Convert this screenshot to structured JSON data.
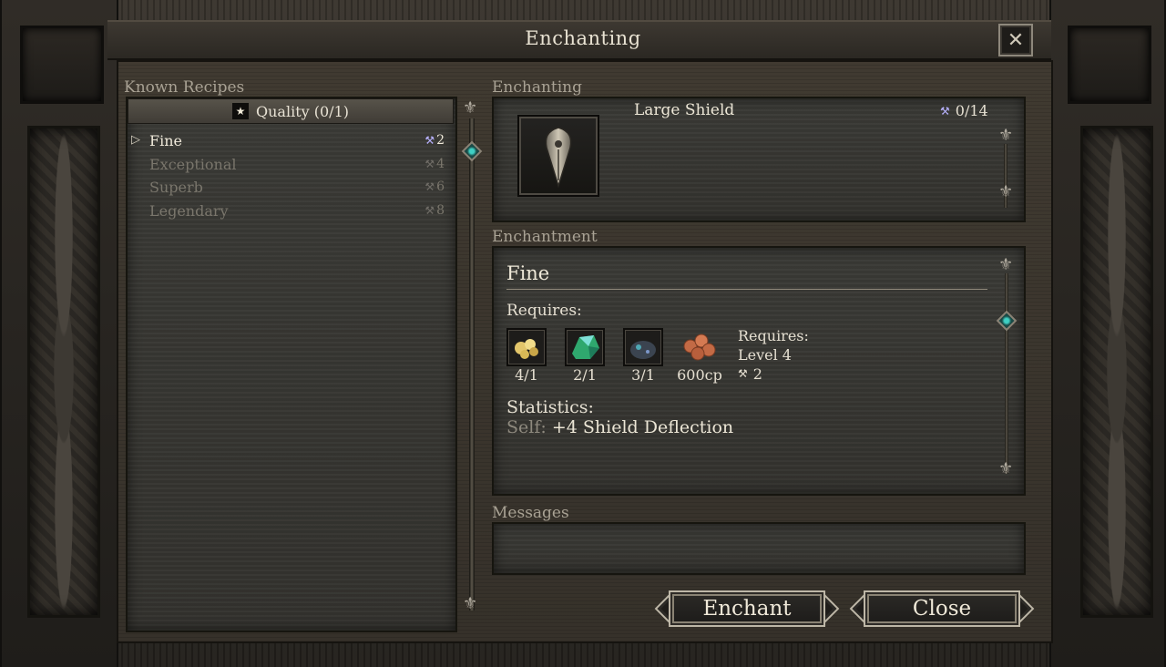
{
  "window": {
    "title": "Enchanting",
    "close_symbol": "✕"
  },
  "recipes": {
    "label": "Known Recipes",
    "filter": {
      "label": "Quality (0/1)",
      "icon": "star-icon"
    },
    "items": [
      {
        "name": "Fine",
        "cost": "2",
        "state": "selected"
      },
      {
        "name": "Exceptional",
        "cost": "4",
        "state": "disabled"
      },
      {
        "name": "Superb",
        "cost": "6",
        "state": "disabled"
      },
      {
        "name": "Legendary",
        "cost": "8",
        "state": "disabled"
      }
    ]
  },
  "enchanting": {
    "label": "Enchanting",
    "item_name": "Large Shield",
    "item_icon": "large-shield-icon",
    "capacity": "0/14"
  },
  "enchantment": {
    "label": "Enchantment",
    "name": "Fine",
    "requires_label": "Requires:",
    "ingredients": [
      {
        "icon": "gold-nugget-icon",
        "count": "4/1"
      },
      {
        "icon": "green-gem-icon",
        "count": "2/1"
      },
      {
        "icon": "dark-ore-icon",
        "count": "3/1"
      },
      {
        "icon": "copper-coins-icon",
        "count": "600cp"
      }
    ],
    "requirement": {
      "label": "Requires:",
      "level": "Level 4",
      "cost": "2"
    },
    "statistics_label": "Statistics:",
    "stat_target": "Self:",
    "stat_value": "+4 Shield Deflection"
  },
  "messages": {
    "label": "Messages"
  },
  "buttons": {
    "enchant": "Enchant",
    "close": "Close"
  },
  "colors": {
    "accent": "#b8b2ff",
    "gem": "#3fd0c4"
  }
}
